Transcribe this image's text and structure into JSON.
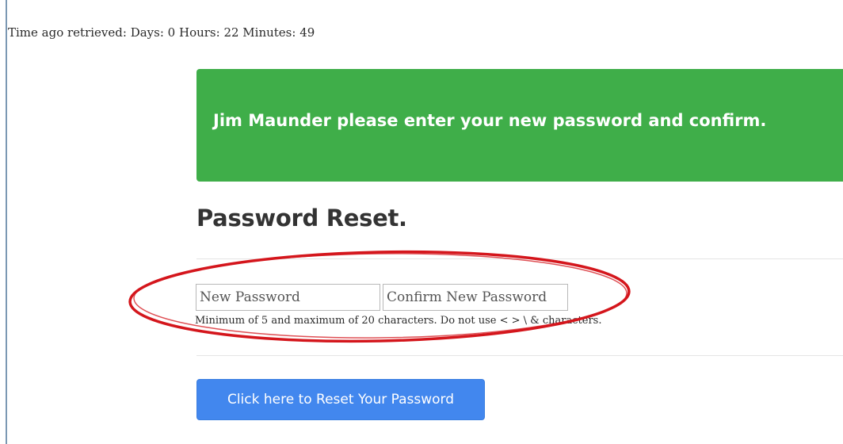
{
  "time_ago": "Time ago retrieved: Days: 0 Hours: 22 Minutes: 49",
  "banner": {
    "message": "Jim Maunder please enter your new password and confirm.",
    "color": "#3fae49"
  },
  "page_title": "Password Reset.",
  "form": {
    "new_password_placeholder": "New Password",
    "confirm_password_placeholder": "Confirm New Password",
    "hint": "Minimum of 5 and maximum of 20 characters. Do not use < > \\ & characters."
  },
  "reset_button": {
    "label": "Click here to Reset Your Password",
    "color": "#4287ee"
  },
  "annotation": {
    "color": "#d4161c"
  }
}
